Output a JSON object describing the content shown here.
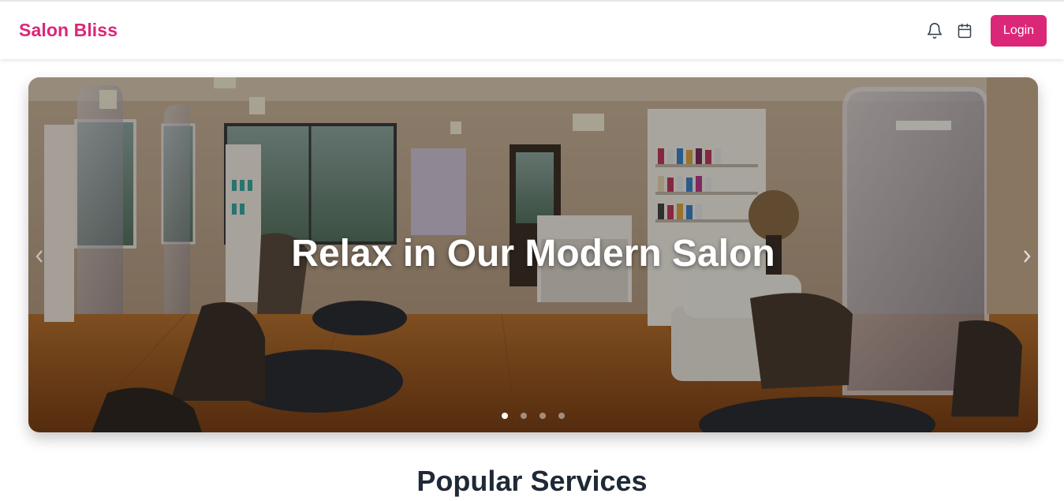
{
  "header": {
    "brand": "Salon Bliss",
    "login_label": "Login",
    "icons": [
      "bell-icon",
      "calendar-icon"
    ]
  },
  "hero": {
    "title": "Relax in Our Modern Salon",
    "slide_count": 4,
    "active_slide": 1,
    "image": "salon-interior-photo"
  },
  "sections": {
    "popular_title": "Popular Services"
  },
  "colors": {
    "brand": "#db2777",
    "heading": "#1f2937"
  }
}
